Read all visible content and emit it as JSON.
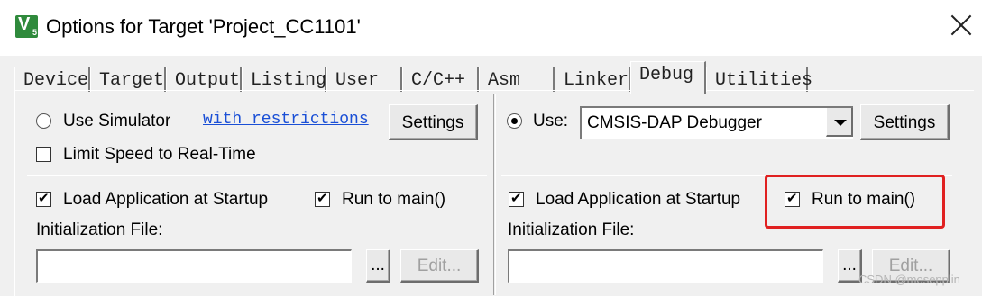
{
  "window": {
    "title": "Options for Target 'Project_CC1101'",
    "icon_glyph": "V",
    "icon_subscript": "5"
  },
  "tabs": [
    {
      "label": "Device"
    },
    {
      "label": "Target"
    },
    {
      "label": "Output"
    },
    {
      "label": "Listing"
    },
    {
      "label": "User"
    },
    {
      "label": "C/C++"
    },
    {
      "label": "Asm"
    },
    {
      "label": "Linker"
    },
    {
      "label": "Debug",
      "active": true
    },
    {
      "label": "Utilities"
    }
  ],
  "left": {
    "use_simulator_label": "Use Simulator",
    "use_simulator_selected": false,
    "restrictions_link": "with restrictions",
    "settings_label": "Settings",
    "limit_speed_label": "Limit Speed to Real-Time",
    "limit_speed_checked": false,
    "load_app_label": "Load Application at Startup",
    "load_app_checked": true,
    "run_main_label": "Run to main()",
    "run_main_checked": true,
    "init_file_label": "Initialization File:",
    "init_file_value": "",
    "browse_label": "...",
    "edit_label": "Edit..."
  },
  "right": {
    "use_label": "Use:",
    "use_selected": true,
    "debugger_value": "CMSIS-DAP Debugger",
    "settings_label": "Settings",
    "load_app_label": "Load Application at Startup",
    "load_app_checked": true,
    "run_main_label": "Run to main()",
    "run_main_checked": true,
    "init_file_label": "Initialization File:",
    "init_file_value": "",
    "browse_label": "...",
    "edit_label": "Edit..."
  },
  "highlight_color": "#e02020",
  "watermark": "CSDN @mosepplin"
}
